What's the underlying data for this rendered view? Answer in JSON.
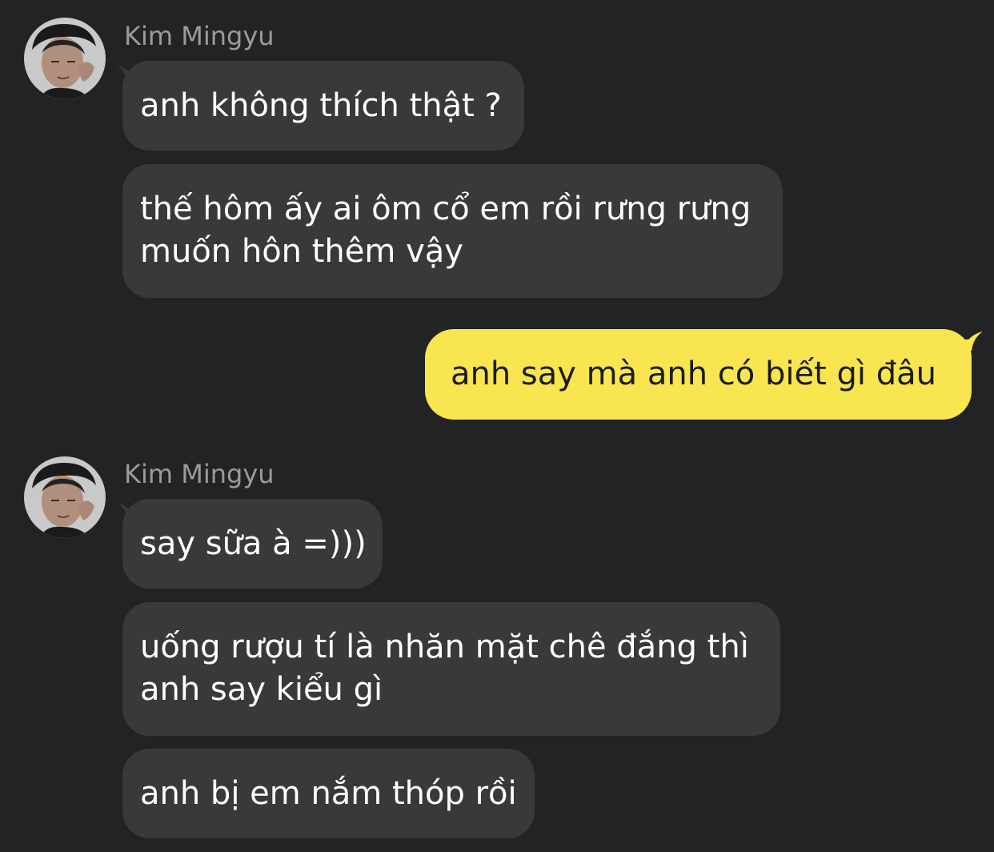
{
  "colors": {
    "background": "#232325",
    "incoming_bubble": "#39393c",
    "outgoing_bubble": "#f8e550",
    "sender_name": "#9b9b9d"
  },
  "groups": [
    {
      "sender": "Kim Mingyu",
      "avatar_icon": "profile-photo-avatar",
      "messages": [
        {
          "lines": [
            "anh không thích thật ?"
          ]
        },
        {
          "lines": [
            "thế hôm ấy ai ôm cổ em rồi rưng rưng",
            "muốn hôn thêm vậy"
          ]
        }
      ]
    },
    {
      "sender": "me",
      "messages": [
        {
          "lines": [
            "anh say mà anh có biết gì đâu"
          ]
        }
      ]
    },
    {
      "sender": "Kim Mingyu",
      "avatar_icon": "profile-photo-avatar",
      "messages": [
        {
          "lines": [
            "say sữa à =)))"
          ]
        },
        {
          "lines": [
            "uống rượu tí là nhăn mặt chê đắng thì",
            "anh say kiểu gì"
          ]
        },
        {
          "lines": [
            "anh bị em nắm thóp rồi"
          ]
        }
      ]
    }
  ]
}
